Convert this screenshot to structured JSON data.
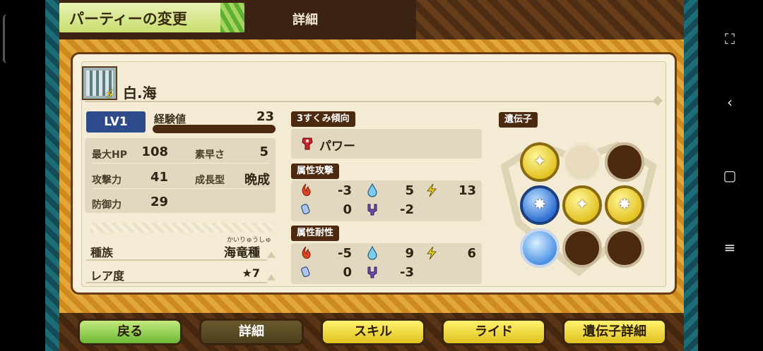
{
  "header": {
    "title": "パーティーの変更",
    "active_tab": "詳細"
  },
  "monster": {
    "name": "白.海",
    "level": "LV1",
    "exp_label": "経験値",
    "exp_value": "23",
    "exp_progress": 1.0,
    "element_badge": "bolt-icon"
  },
  "stats": {
    "max_hp_label": "最大HP",
    "max_hp": "108",
    "speed_label": "素早さ",
    "speed": "5",
    "attack_label": "攻撃力",
    "attack": "41",
    "growth_label": "成長型",
    "growth": "晩成",
    "defense_label": "防御力",
    "defense": "29"
  },
  "species": {
    "label": "種族",
    "value": "海竜種",
    "furigana": "かいりゅうしゅ"
  },
  "rarity": {
    "label": "レア度",
    "value": "★7"
  },
  "tendency": {
    "label": "3すくみ傾向",
    "value": "パワー"
  },
  "attribute_attack": {
    "label": "属性攻撃",
    "fire": "-3",
    "water": "5",
    "thunder": "13",
    "ice": "0",
    "dragon": "-2"
  },
  "attribute_resist": {
    "label": "属性耐性",
    "fire": "-5",
    "water": "9",
    "thunder": "6",
    "ice": "0",
    "dragon": "-3"
  },
  "genes": {
    "label": "遺伝子",
    "slots": [
      "yellow-skill",
      "empty",
      "dark",
      "blue-skill",
      "yellow-skill",
      "yellow-skill",
      "blue-orb",
      "dark",
      "dark"
    ]
  },
  "buttons": {
    "back": "戻る",
    "detail": "詳細",
    "skill": "スキル",
    "ride": "ライド",
    "gene_detail": "遺伝子詳細"
  },
  "colors": {
    "fire": "#e0431f",
    "water": "#5fb7e6",
    "thunder": "#e8cb1a",
    "ice": "#6fa0d8",
    "dragon": "#5a3d9e",
    "level_badge": "#2e4a8a"
  }
}
